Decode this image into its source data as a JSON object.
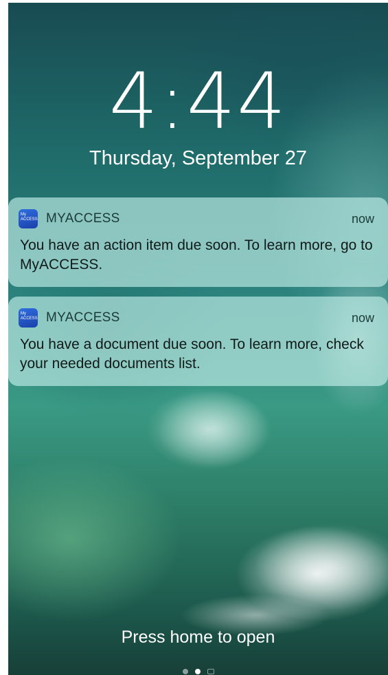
{
  "lockscreen": {
    "time": "4:44",
    "date": "Thursday, September 27"
  },
  "notifications": [
    {
      "app_icon": "myaccess-app-icon",
      "app_icon_text": "My ACCESS",
      "app_name": "MYACCESS",
      "time": "now",
      "message": "You have an action item due soon. To learn more, go to MyACCESS."
    },
    {
      "app_icon": "myaccess-app-icon",
      "app_icon_text": "My ACCESS",
      "app_name": "MYACCESS",
      "time": "now",
      "message": "You have a document due soon. To learn more, check your needed documents list."
    }
  ],
  "footer": {
    "hint": "Press home to open"
  },
  "page_indicator": {
    "pages": 3,
    "active_index": 1,
    "icons": [
      "dot",
      "dot",
      "camera-icon"
    ]
  },
  "colors": {
    "card_background": "#bdebe4",
    "app_icon": "#2f6fe0",
    "text_primary": "#101a19",
    "lockscreen_text": "#ffffff"
  }
}
